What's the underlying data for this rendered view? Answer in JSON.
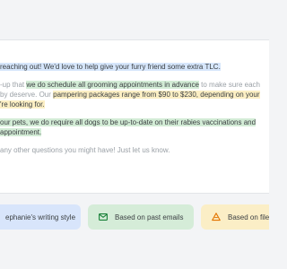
{
  "email": {
    "line1": "reaching out! We'd love to help give your furry friend some extra TLC.",
    "line2_a": "-up that ",
    "line2_b": "we do schedule all grooming appointments in advance",
    "line2_c": " to make sure each",
    "line3_a": "by deserve. Our ",
    "line3_b": "pampering packages range from $90 to $230, depending on your",
    "line4": "'re looking for.",
    "line5": "our pets, we do require all dogs to be up-to-date on their rabies vaccinations and",
    "line6": "appointment.",
    "line7": " any other questions you might have! Just let us know."
  },
  "chips": [
    {
      "label": "ephanie's writing style",
      "icon": "none",
      "color": "#d8e5fb"
    },
    {
      "label": "Based on past emails",
      "icon": "mail-icon",
      "color": "#d5ecd8"
    },
    {
      "label": "Based on file",
      "icon": "drive-icon",
      "color": "#fbeec6"
    }
  ],
  "colors": {
    "highlight_blue": "#d6e6fb",
    "highlight_green": "#d3ecd6",
    "highlight_yellow": "#fcefc4"
  }
}
